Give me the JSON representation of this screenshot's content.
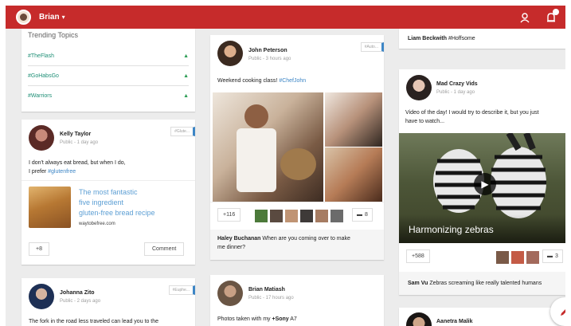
{
  "topbar": {
    "username": "Brian",
    "caret": "▾",
    "profile_icon": "person-circle-icon",
    "notif_icon": "bell-icon",
    "color": "#c62b2b"
  },
  "trending": {
    "title": "Trending Topics",
    "topics": [
      "#TheFlash",
      "#GoHabsGo",
      "#Warriors"
    ]
  },
  "kelly": {
    "name": "Kelly Taylor",
    "meta": "Public - 1 day ago",
    "tag": "#Glute...",
    "text1": "I don't always eat bread, but when I do,",
    "text2": "I prefer ",
    "hashtag": "#glutenfree",
    "link_title_1": "The most fantastic",
    "link_title_2": "five ingredient",
    "link_title_3": "gluten-free bread recipe",
    "link_domain": "waytobefree.com",
    "plus": "+8",
    "comment": "Comment"
  },
  "johanna": {
    "name": "Johanna Zito",
    "meta": "Public - 2 days ago",
    "tag": "#Euphe...",
    "text": "The fork in the road less traveled can lead you to the"
  },
  "john": {
    "name": "John Peterson",
    "meta": "Public - 3 hours ago",
    "tag": "#Auto...",
    "text": "Weekend cooking class! ",
    "hashtag": "#ChefJohn",
    "plus": "+116",
    "comments": "8",
    "commenter": "Haley Buchanan",
    "comment": "When are you coming over to make",
    "comment2": "me dinner?"
  },
  "brian": {
    "name": "Brian Matiash",
    "meta": "Public - 17 hours ago",
    "text": "Photos taken with my ",
    "bold": "+Sony",
    "text2": " A7"
  },
  "liam": {
    "name": "Liam Beckwith",
    "hashtag": "#Hoffsome"
  },
  "mad": {
    "name": "Mad Crazy Vids",
    "meta": "Public - 1 day ago",
    "text1": "Video of the day! I would try to describe it, but you just",
    "text2": "have to watch...",
    "video_title": "Harmonizing zebras",
    "plus": "+588",
    "comments": "3",
    "commenter": "Sam Vu",
    "comment": "Zebras screaming like really talented humans"
  },
  "aanetra": {
    "name": "Aanetra Malik"
  },
  "fab_icon": "pencil-icon"
}
